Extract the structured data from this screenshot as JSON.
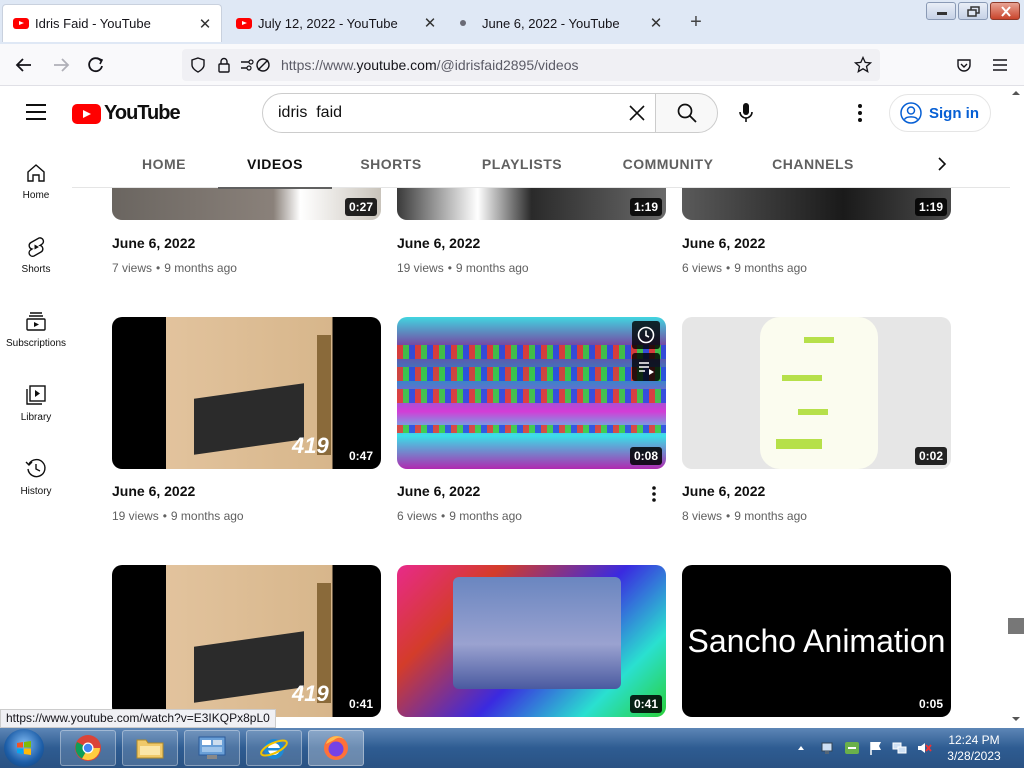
{
  "browser": {
    "tabs": [
      {
        "title": "Idris Faid - YouTube",
        "active": true
      },
      {
        "title": "July 12, 2022 - YouTube",
        "active": false
      },
      {
        "title": "June 6, 2022 - YouTube",
        "active": false
      }
    ],
    "url_prefix": "https://www.",
    "url_domain": "youtube.com",
    "url_path": "/@idrisfaid2895/videos",
    "status_url": "https://www.youtube.com/watch?v=E3IKQPx8pL0"
  },
  "youtube": {
    "logo_text": "YouTube",
    "search_value": "idris  faid",
    "sign_in": "Sign in",
    "sidebar": [
      {
        "label": "Home",
        "icon": "home-icon"
      },
      {
        "label": "Shorts",
        "icon": "shorts-icon"
      },
      {
        "label": "Subscriptions",
        "icon": "subscriptions-icon"
      },
      {
        "label": "Library",
        "icon": "library-icon"
      },
      {
        "label": "History",
        "icon": "history-icon"
      }
    ],
    "channel_tabs": [
      "HOME",
      "VIDEOS",
      "SHORTS",
      "PLAYLISTS",
      "COMMUNITY",
      "CHANNELS"
    ],
    "active_tab": "VIDEOS",
    "videos": [
      {
        "title": "June 6, 2022",
        "views": "7 views",
        "age": "9 months ago",
        "duration": "0:27"
      },
      {
        "title": "June 6, 2022",
        "views": "19 views",
        "age": "9 months ago",
        "duration": "1:19"
      },
      {
        "title": "June 6, 2022",
        "views": "6 views",
        "age": "9 months ago",
        "duration": "1:19"
      },
      {
        "title": "June 6, 2022",
        "views": "19 views",
        "age": "9 months ago",
        "duration": "0:47"
      },
      {
        "title": "June 6, 2022",
        "views": "6 views",
        "age": "9 months ago",
        "duration": "0:08"
      },
      {
        "title": "June 6, 2022",
        "views": "8 views",
        "age": "9 months ago",
        "duration": "0:02"
      },
      {
        "title": "",
        "views": "",
        "age": "",
        "duration": "0:41"
      },
      {
        "title": "",
        "views": "",
        "age": "",
        "duration": "0:41"
      },
      {
        "title": "",
        "views": "",
        "age": "",
        "duration": "0:05",
        "thumb_text": "Sancho Animation"
      }
    ],
    "thumb_overlay_number": "419"
  },
  "taskbar": {
    "time": "12:24 PM",
    "date": "3/28/2023"
  }
}
